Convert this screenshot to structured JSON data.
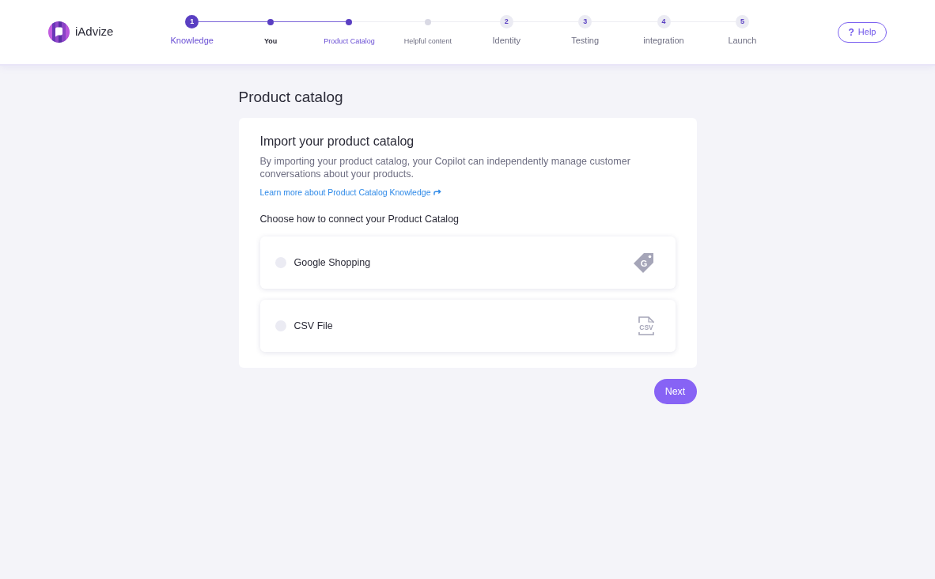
{
  "header": {
    "brand": "iAdvize",
    "help_button": {
      "icon": "?",
      "label": "Help"
    }
  },
  "stepper": [
    {
      "kind": "step",
      "number": "1",
      "label": "Knowledge",
      "current": true,
      "completed": false
    },
    {
      "kind": "substep",
      "label": "You",
      "current": false,
      "completed": true
    },
    {
      "kind": "substep",
      "label": "Product Catalog",
      "current": true,
      "completed": false
    },
    {
      "kind": "substep",
      "label": "Helpful content",
      "current": false,
      "completed": false
    },
    {
      "kind": "step",
      "number": "2",
      "label": "Identity",
      "current": false,
      "completed": false
    },
    {
      "kind": "step",
      "number": "3",
      "label": "Testing",
      "current": false,
      "completed": false
    },
    {
      "kind": "step",
      "number": "4",
      "label": "integration",
      "current": false,
      "completed": false
    },
    {
      "kind": "step",
      "number": "5",
      "label": "Launch",
      "current": false,
      "completed": false
    }
  ],
  "page_title": "Product catalog",
  "card": {
    "title": "Import your product catalog",
    "description": "By importing your product catalog, your Copilot can independently manage customer conversations about your products.",
    "link": "Learn more about Product Catalog Knowledge",
    "options_heading": "Choose how to connect your Product Catalog",
    "options": [
      {
        "kind": "google",
        "label": "Google Shopping",
        "icon_text": "G",
        "selected": false
      },
      {
        "kind": "csv",
        "label": "CSV File",
        "icon_text": "CSV",
        "selected": false
      }
    ]
  },
  "next_button": "Next"
}
